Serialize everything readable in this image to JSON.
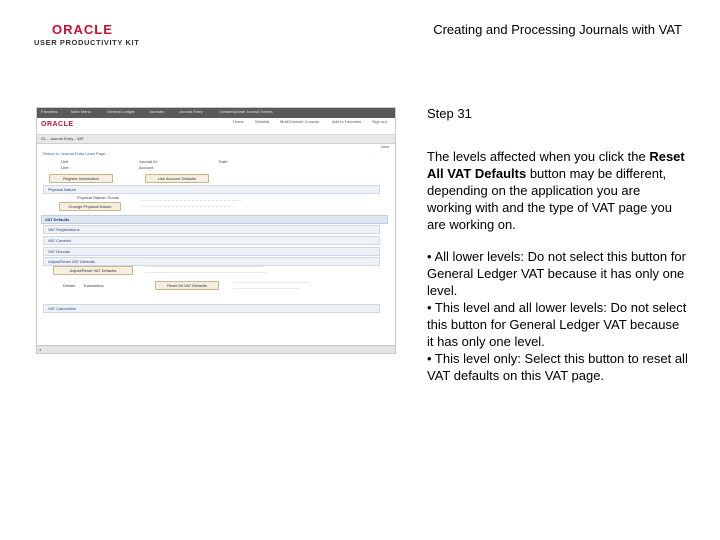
{
  "logo": {
    "brand": "ORACLE",
    "product": "USER PRODUCTIVITY KIT"
  },
  "document_title": "Creating and Processing Journals with VAT",
  "step": "Step 31",
  "description": {
    "intro": "The levels affected when you click the ",
    "button_name": "Reset All VAT Defaults",
    "rest": " button may be different, depending on the application you are working with and the type of VAT page you are working on."
  },
  "bullets": [
    "• All lower levels: Do not select this button for General Ledger VAT because it has only one level.",
    "• This level and all lower levels: Do not select this button for General Ledger VAT because it has only one level.",
    "• This level only: Select this button to reset all VAT defaults on this VAT page."
  ],
  "screenshot": {
    "menu_items": [
      "Favorites",
      "Main Menu",
      "General Ledger",
      "Journals",
      "Journal Entry",
      "Create/Update Journal Entries"
    ],
    "brand": "ORACLE",
    "nav_links": [
      "Home",
      "Worklist",
      "MultiChannel Console",
      "Add to Favorites",
      "Sign out"
    ],
    "breadcrumb": "GL - Journal Entry - VAT",
    "new_window": "New",
    "return_link": "Return to Journal Entry Lines Page",
    "unit": "Unit",
    "journal_id": "Journal ID",
    "date": "Date",
    "line": "Line",
    "account": "Account",
    "reg_button": "Register Information",
    "use_account_button": "Use Account Defaults",
    "physical_nature_header": "Physical Nature",
    "physical_nature_label": "Physical Nature: Goods",
    "change_physical_nature": "Change Physical Nature",
    "vat_defaults_header": "VAT Defaults",
    "sections": [
      "VAT Registrations",
      "VAT Controls",
      "VAT Rounds",
      "Adjust/Reset VAT Defaults"
    ],
    "reset_button": "Adjust/Reset VAT Defaults",
    "details_label": "Details",
    "transaction_label": "Transaction",
    "reset_all_button": "Reset All VAT Defaults",
    "vat_calc_header": "VAT Calculation"
  }
}
